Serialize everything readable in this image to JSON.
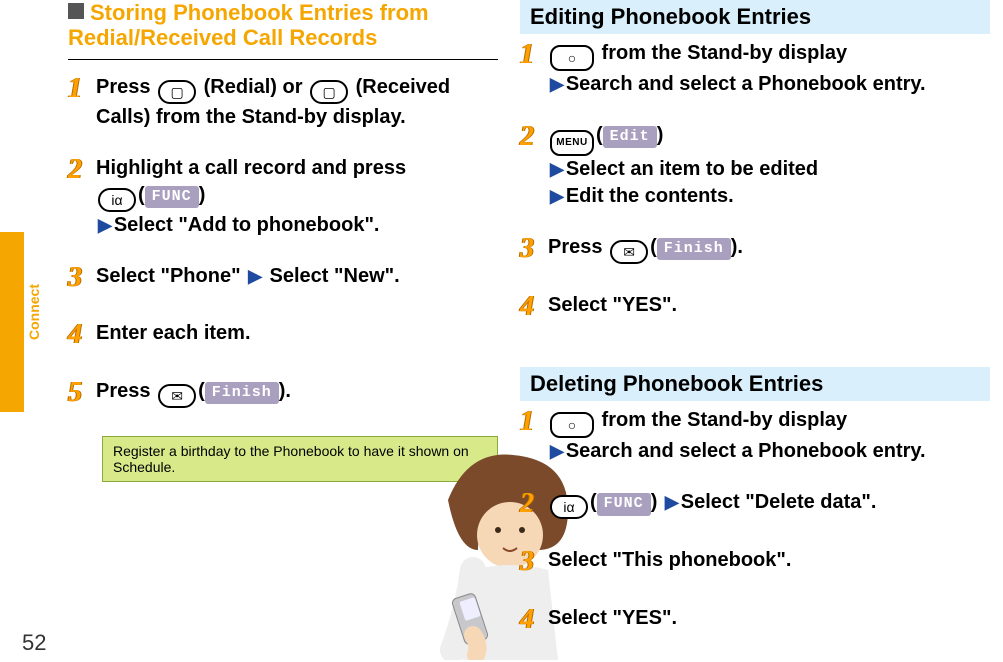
{
  "sidebar": {
    "label": "Connect",
    "page_number": "52"
  },
  "left": {
    "heading": "Storing Phonebook Entries from Redial/Received Call Records",
    "steps": {
      "s1": {
        "num": "1",
        "t1": "Press ",
        "k1_glyph": "▢",
        "t2": "(Redial) or ",
        "k2_glyph": "▢",
        "t3": "(Received Calls) from the Stand-by display."
      },
      "s2": {
        "num": "2",
        "line1a": "Highlight a call record and press ",
        "k_glyph": "iα",
        "lcd": "FUNC",
        "line2": "Select \"Add to phonebook\"."
      },
      "s3": {
        "num": "3",
        "t1": "Select \"Phone\"",
        "t2": "Select \"New\"."
      },
      "s4": {
        "num": "4",
        "t": "Enter each item."
      },
      "s5": {
        "num": "5",
        "t1": "Press ",
        "k_glyph": "✉",
        "lcd": "Finish",
        "t2": "."
      }
    },
    "tip": "Register a birthday to the Phonebook to have it shown on Schedule."
  },
  "right": {
    "edit": {
      "heading": "Editing Phonebook Entries",
      "s1": {
        "num": "1",
        "k_glyph": "○",
        "t1": " from the Stand-by display",
        "t2": "Search and select a Phonebook entry."
      },
      "s2": {
        "num": "2",
        "key_label": "MENU",
        "lcd": " Edit ",
        "t2": "Select an item to be edited",
        "t3": "Edit the contents."
      },
      "s3": {
        "num": "3",
        "t1": "Press ",
        "k_glyph": "✉",
        "lcd": "Finish",
        "t2": "."
      },
      "s4": {
        "num": "4",
        "t": "Select \"YES\"."
      }
    },
    "del": {
      "heading": "Deleting Phonebook Entries",
      "s1": {
        "num": "1",
        "k_glyph": "○",
        "t1": " from the Stand-by display",
        "t2": "Search and select a Phonebook entry."
      },
      "s2": {
        "num": "2",
        "k_glyph": "iα",
        "lcd": "FUNC",
        "t2": "Select \"Delete data\"."
      },
      "s3": {
        "num": "3",
        "t": "Select \"This phonebook\"."
      },
      "s4": {
        "num": "4",
        "t": "Select \"YES\"."
      }
    }
  }
}
